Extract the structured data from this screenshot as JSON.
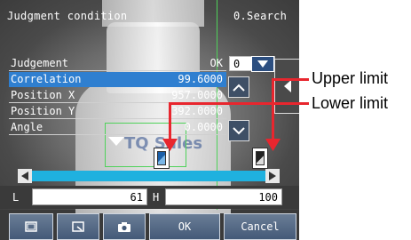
{
  "header": {
    "title": "Judgment condition",
    "mode": "0.Search"
  },
  "params": [
    {
      "name": "Judgement",
      "value": "OK"
    },
    {
      "name": "Correlation",
      "value": "99.6000"
    },
    {
      "name": "Position X",
      "value": "957.0000"
    },
    {
      "name": "Position Y",
      "value": "392.0000"
    },
    {
      "name": "Angle",
      "value": "0.0000"
    }
  ],
  "dropdown": {
    "value": "0"
  },
  "image_text": "TQ Sales",
  "range": {
    "lower_label": "L",
    "lower_value": "61",
    "upper_label": "H",
    "upper_value": "100",
    "lower_fraction": 0.61,
    "upper_fraction": 1.0
  },
  "buttons": {
    "ok": "OK",
    "cancel": "Cancel"
  },
  "annotations": {
    "upper": "Upper limit",
    "lower": "Lower limit"
  },
  "colors": {
    "highlight": "#2f7fd0",
    "slider": "#1fb1df",
    "callout": "#e8262e",
    "roi": "#4fd25a"
  }
}
